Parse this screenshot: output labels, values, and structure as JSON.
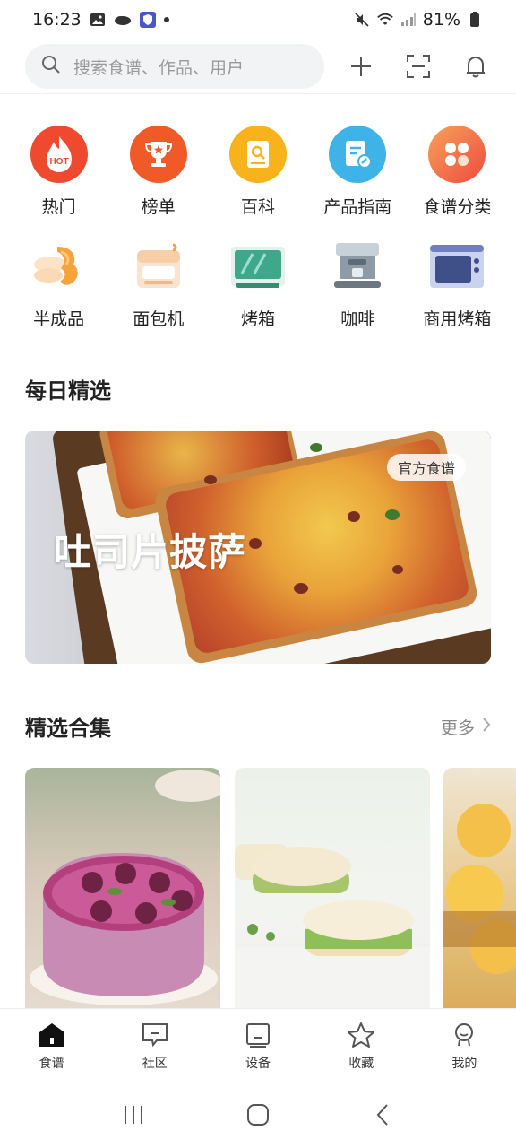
{
  "status_bar": {
    "time": "16:23",
    "battery": "81%"
  },
  "search": {
    "placeholder": "搜索食谱、作品、用户"
  },
  "categories": [
    {
      "label": "热门",
      "icon": "hot-icon",
      "badge": "HOT"
    },
    {
      "label": "榜单",
      "icon": "trophy-icon"
    },
    {
      "label": "百科",
      "icon": "encyclopedia-icon"
    },
    {
      "label": "产品指南",
      "icon": "product-guide-icon"
    },
    {
      "label": "食谱分类",
      "icon": "recipe-category-icon"
    },
    {
      "label": "半成品",
      "icon": "semi-finished-icon"
    },
    {
      "label": "面包机",
      "icon": "bread-machine-icon"
    },
    {
      "label": "烤箱",
      "icon": "oven-icon"
    },
    {
      "label": "咖啡",
      "icon": "coffee-machine-icon"
    },
    {
      "label": "商用烤箱",
      "icon": "commercial-oven-icon"
    }
  ],
  "daily": {
    "title": "每日精选",
    "banner_title": "吐司片披萨",
    "badge": "官方食谱"
  },
  "collections": {
    "title": "精选合集",
    "more": "更多"
  },
  "tabs": [
    {
      "label": "食谱",
      "icon": "home-icon",
      "active": true
    },
    {
      "label": "社区",
      "icon": "community-icon"
    },
    {
      "label": "设备",
      "icon": "device-icon"
    },
    {
      "label": "收藏",
      "icon": "star-icon"
    },
    {
      "label": "我的",
      "icon": "profile-icon"
    }
  ],
  "colors": {
    "accent": "#f05a28",
    "text": "#222222",
    "muted": "#999999"
  }
}
